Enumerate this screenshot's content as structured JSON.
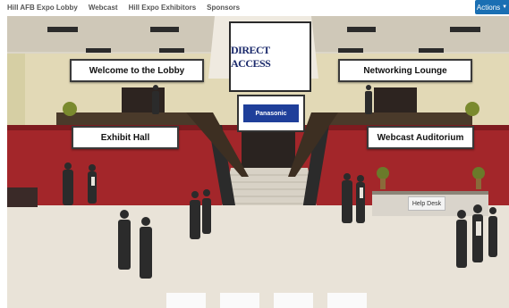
{
  "nav": {
    "items": [
      "Hill AFB Expo Lobby",
      "Webcast",
      "Hill Expo Exhibitors",
      "Sponsors"
    ],
    "actions_label": "Actions",
    "actions_icon": "chevron-down-icon"
  },
  "lobby": {
    "welcome_sign": "Welcome to the Lobby",
    "networking_sign": "Networking Lounge",
    "exhibit_sign": "Exhibit Hall",
    "webcast_sign": "Webcast Auditorium",
    "logo_text": "DIRECT ACCESS",
    "sponsor_text": "Panasonic",
    "help_desk": "Help Desk"
  },
  "colors": {
    "accent": "#1a6fb3",
    "wall_red": "#a3262a",
    "floor": "#ece7de"
  }
}
